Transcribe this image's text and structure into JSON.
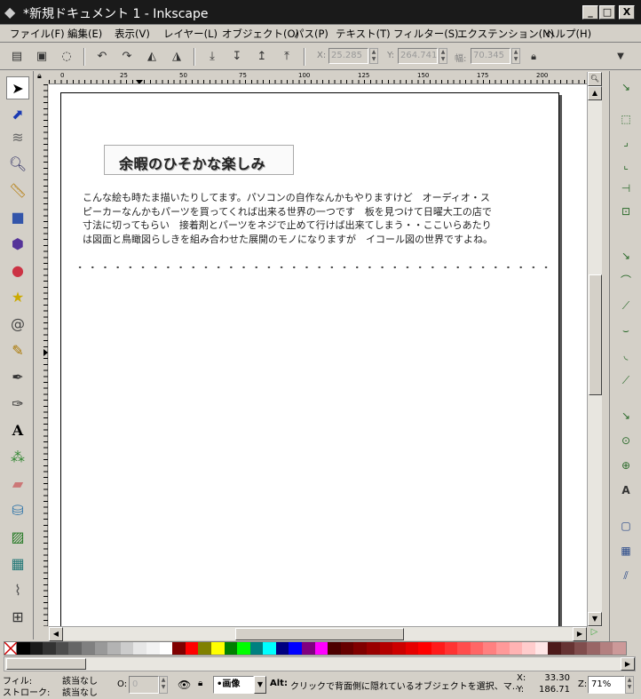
{
  "window": {
    "title": "*新規ドキュメント 1 - Inkscape",
    "minimize": "_",
    "maximize": "□",
    "close": "X"
  },
  "menu": [
    "ファイル(F)",
    "編集(E)",
    "表示(V)",
    "レイヤー(L)",
    "オブジェクト(O)",
    "パス(P)",
    "テキスト(T)",
    "フィルター(S)",
    "エクステンション(N)",
    "ヘルプ(H)"
  ],
  "toolbar": {
    "x_label": "X:",
    "x_value": "25.285",
    "y_label": "Y:",
    "y_value": "264.741",
    "w_label": "幅:",
    "w_value": "70.345"
  },
  "ruler": {
    "h_ticks": [
      "0",
      "25",
      "50",
      "75",
      "100",
      "125",
      "150",
      "175",
      "200"
    ],
    "v_ticks": [
      "0",
      "50",
      "75",
      "100",
      "125",
      "150",
      "175",
      "200",
      "225",
      "250",
      "275",
      "300"
    ]
  },
  "document": {
    "heading": "余暇のひそかな楽しみ",
    "body_lines": [
      "こんな絵も時たま描いたりしてます。パソコンの自作なんかもやりますけど　オーディオ・ス",
      "ピーカーなんかもパーツを買ってくれば出来る世界の一つです　板を見つけて日曜大工の店で",
      "寸法に切ってもらい　接着剤とパーツをネジで止めて行けば出来てしまう・・ここいらあたり",
      "は図面と鳥瞰図らしきを組み合わせた展開のモノになりますが　イコール図の世界ですよね。"
    ]
  },
  "palette": [
    "#000000",
    "#1a1a1a",
    "#333333",
    "#4d4d4d",
    "#666666",
    "#808080",
    "#999999",
    "#b3b3b3",
    "#cccccc",
    "#e6e6e6",
    "#f2f2f2",
    "#ffffff",
    "#800000",
    "#ff0000",
    "#808000",
    "#ffff00",
    "#008000",
    "#00ff00",
    "#008080",
    "#00ffff",
    "#000080",
    "#0000ff",
    "#800080",
    "#ff00ff",
    "#4d0000",
    "#660000",
    "#800000",
    "#990000",
    "#b30000",
    "#cc0000",
    "#e60000",
    "#ff0000",
    "#ff1a1a",
    "#ff3333",
    "#ff4d4d",
    "#ff6666",
    "#ff8080",
    "#ff9999",
    "#ffb3b3",
    "#ffcccc",
    "#ffe6e6",
    "#4d1a1a",
    "#663333",
    "#804d4d",
    "#996666",
    "#b38080",
    "#cc9999"
  ],
  "status": {
    "fill_label": "フィル:",
    "fill_value": "該当なし",
    "stroke_label": "ストローク:",
    "stroke_value": "該当なし",
    "opacity_label": "O:",
    "opacity_value": "0",
    "layer_value": "•画像",
    "message_bold": "Alt:",
    "message": "クリックで背面側に隠れているオブジェクトを選択、マ…",
    "x_label": "X:",
    "x_value": "33.30",
    "y_label": "Y:",
    "y_value": "186.71",
    "zoom_label": "Z:",
    "zoom_value": "71%"
  }
}
